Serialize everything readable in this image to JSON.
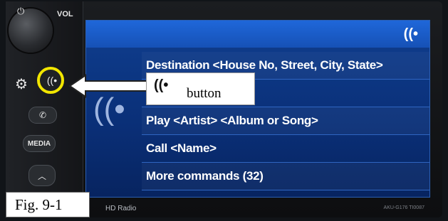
{
  "screen": {
    "commands": [
      "Destination <House No, Street, City, State>",
      "",
      "Play <Artist> <Album or Song>",
      "Call <Name>",
      "More commands (32)"
    ]
  },
  "hardware": {
    "vol_label": "VOL",
    "media_label": "MEDIA",
    "hd_radio_label": "HD Radio",
    "model_label": "AKU-G176 TI0087"
  },
  "callout": {
    "button_label": "button",
    "highlight_color": "#f2e600"
  },
  "figure": {
    "label": "Fig. 9-1"
  },
  "icons": {
    "power": "power-icon",
    "settings": "gear-icon",
    "voice": "voice-command-icon",
    "phone": "phone-icon",
    "up": "chevron-up-icon"
  }
}
